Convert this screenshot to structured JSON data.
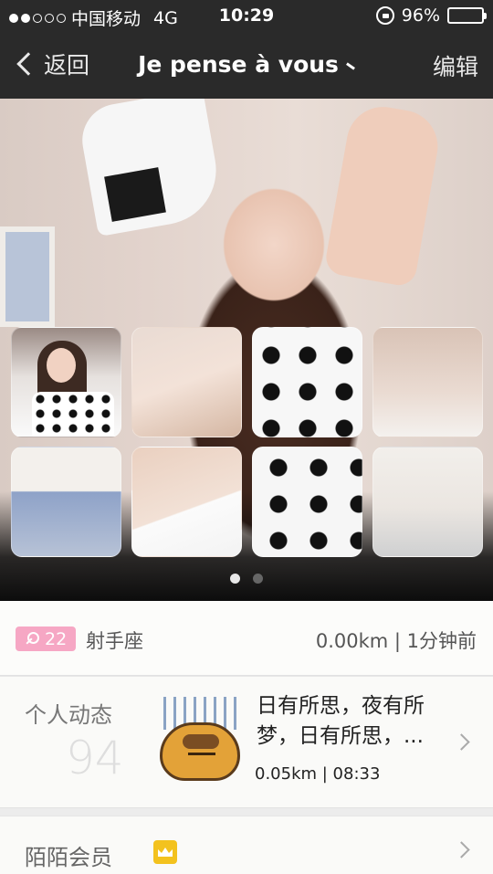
{
  "status_bar": {
    "carrier": "中国移动",
    "network": "4G",
    "time": "10:29",
    "battery": "96%",
    "battery_level": 0.96,
    "signal_bars": 2,
    "signal_total": 5
  },
  "nav": {
    "back_label": "返回",
    "title": "Je pense à vous",
    "edit_label": "编辑"
  },
  "photo_gallery": {
    "thumbnail_count": 8,
    "page_count": 2,
    "active_page": 1
  },
  "profile": {
    "age": "22",
    "gender_icon": "female-icon",
    "zodiac": "射手座",
    "distance_time": "0.00km | 1分钟前",
    "badge_color": "#f6a7c4"
  },
  "activity": {
    "label": "个人动态",
    "count": "94",
    "post_text": "日有所思，夜有所梦，日有所思，...",
    "post_meta": "0.05km | 08:33"
  },
  "membership": {
    "label": "陌陌会员",
    "icon": "crown-icon",
    "icon_color": "#f3c21e"
  }
}
